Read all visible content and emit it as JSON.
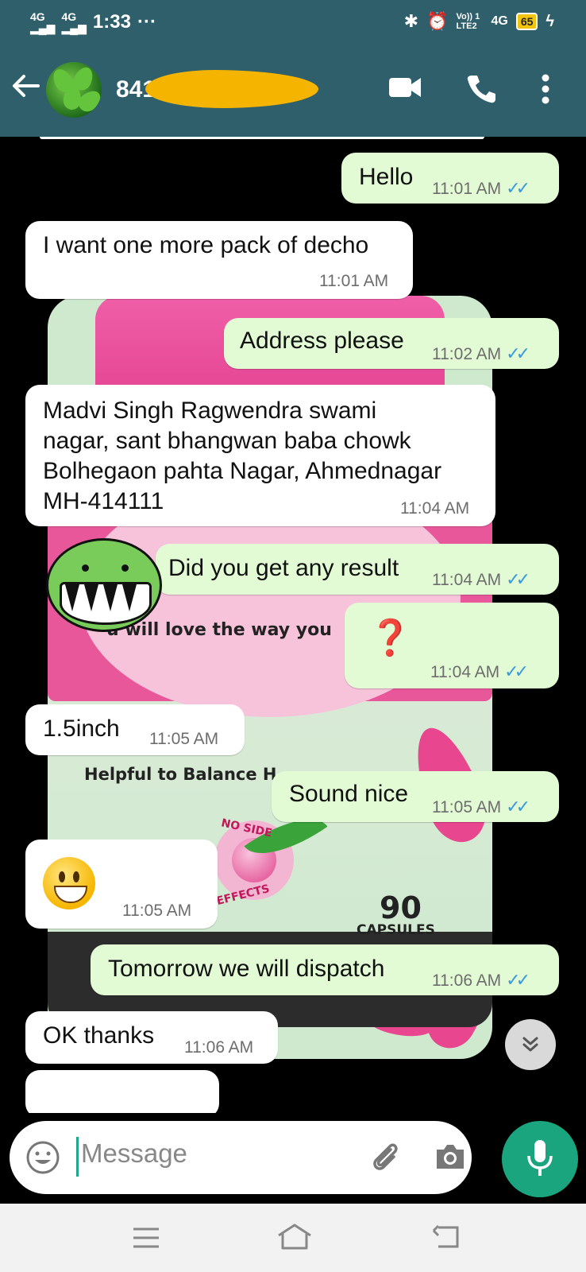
{
  "status_bar": {
    "network_1": "4G",
    "network_2": "4G",
    "time": "1:33",
    "more": "···",
    "volte": "Vo)) 1 LTE2",
    "net_4g": "4G",
    "battery": "65"
  },
  "header": {
    "contact_name": "841"
  },
  "product_background": {
    "tagline": "will love the way you",
    "tagline_prefix": "u",
    "subtitle": "Helpful to Balance H",
    "seal_top": "NO SIDE",
    "seal_bottom": "EFFECTS",
    "count": "90",
    "count_unit": "CAPSULES"
  },
  "messages": [
    {
      "dir": "out",
      "text": "Hello",
      "time": "11:01 AM"
    },
    {
      "dir": "in",
      "text": "I want one more pack of decho",
      "time": "11:01 AM"
    },
    {
      "dir": "out",
      "text": "Address please",
      "time": "11:02 AM"
    },
    {
      "dir": "in",
      "lines": [
        "Madvi Singh Ragwendra swami",
        "nagar, sant bhangwan baba chowk",
        "Bolhegaon pahta Nagar, Ahmednagar",
        "MH-414111"
      ],
      "time": "11:04 AM"
    },
    {
      "dir": "out",
      "text": "Did you get any result",
      "time": "11:04 AM"
    },
    {
      "dir": "out",
      "text": "❓",
      "time": "11:04 AM"
    },
    {
      "dir": "in",
      "text": "1.5inch",
      "time": "11:05 AM"
    },
    {
      "dir": "out",
      "text": "Sound nice",
      "time": "11:05 AM"
    },
    {
      "dir": "in",
      "text": "",
      "emoji": "grinning-face",
      "time": "11:05 AM"
    },
    {
      "dir": "out",
      "text": "Tomorrow we will dispatch",
      "time": "11:06 AM"
    },
    {
      "dir": "in",
      "text": "OK thanks",
      "time": "11:06 AM"
    }
  ],
  "input": {
    "placeholder": "Message"
  },
  "colors": {
    "header": "#305f6c",
    "outgoing_bubble": "#e2fbd5",
    "incoming_bubble": "#ffffff",
    "read_ticks": "#3a9ad9",
    "accent": "#1aa57f",
    "redaction": "#f4b400"
  },
  "icons": {
    "back": "arrow-left-icon",
    "video": "video-call-icon",
    "call": "phone-icon",
    "menu": "more-vert-icon",
    "emoji": "emoji-icon",
    "attach": "paperclip-icon",
    "camera": "camera-icon",
    "mic": "microphone-icon",
    "scroll": "chevron-double-down-icon"
  }
}
